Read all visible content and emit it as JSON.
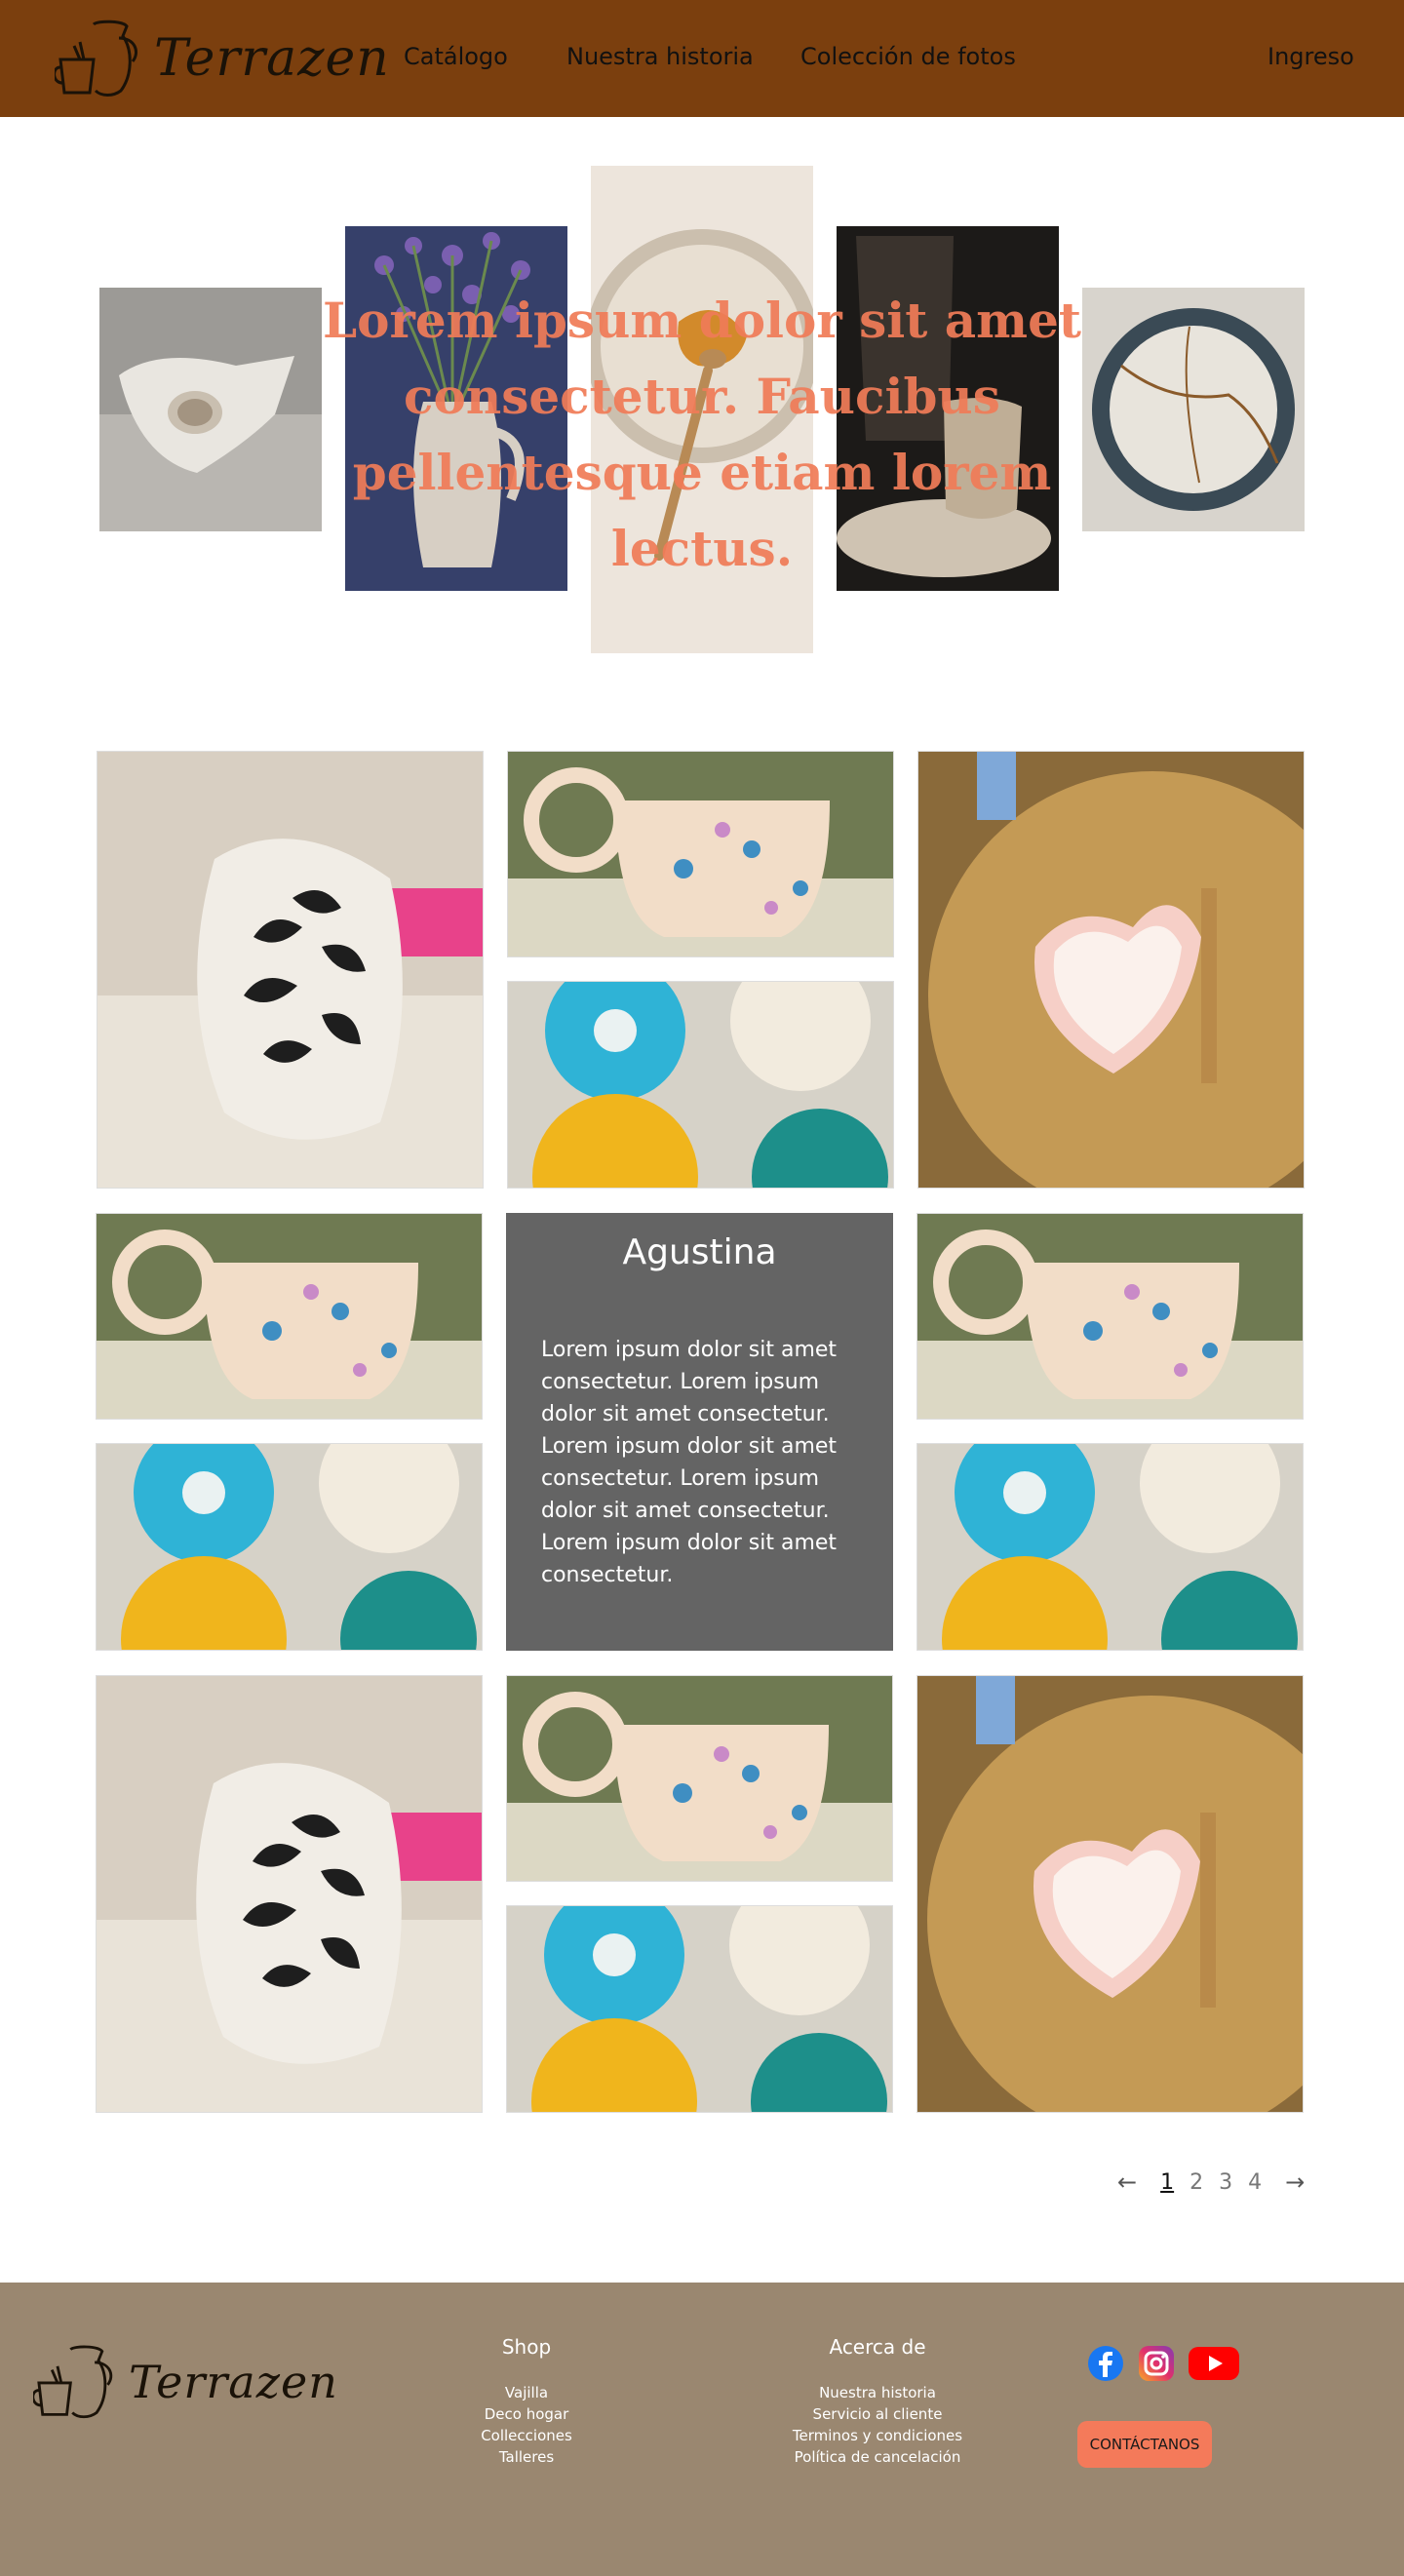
{
  "header": {
    "brand": "Terrazen",
    "nav": [
      "Catálogo",
      "Nuestra historia",
      "Colección de fotos"
    ],
    "login": "Ingreso"
  },
  "hero": {
    "title": "Lorem ipsum dolor sit amet consectetur. Faucibus pellentesque etiam lorem lectus."
  },
  "feature_card": {
    "name": "Agustina",
    "text": "Lorem ipsum dolor sit amet consectetur. Lorem ipsum dolor sit amet consectetur. Lorem ipsum dolor sit amet consectetur. Lorem ipsum dolor sit amet consectetur. Lorem ipsum dolor sit amet consectetur."
  },
  "pagination": {
    "pages": [
      "1",
      "2",
      "3",
      "4"
    ],
    "current": "1",
    "prev_icon": "arrow-left-icon",
    "next_icon": "arrow-right-icon"
  },
  "footer": {
    "brand": "Terrazen",
    "shop": {
      "heading": "Shop",
      "items": [
        "Vajilla",
        "Deco hogar",
        "Collecciones",
        "Talleres"
      ]
    },
    "about": {
      "heading": "Acerca de",
      "items": [
        "Nuestra historia",
        "Servicio al cliente",
        "Terminos y condiciones",
        "Política de cancelación"
      ]
    },
    "social": [
      "facebook-icon",
      "instagram-icon",
      "youtube-icon"
    ],
    "contact_label": "CONTÁCTANOS"
  },
  "colors": {
    "header_bg": "#7b3f0e",
    "footer_bg": "#9a8770",
    "accent": "#f47a5a",
    "hero_title": "#f07c58"
  }
}
